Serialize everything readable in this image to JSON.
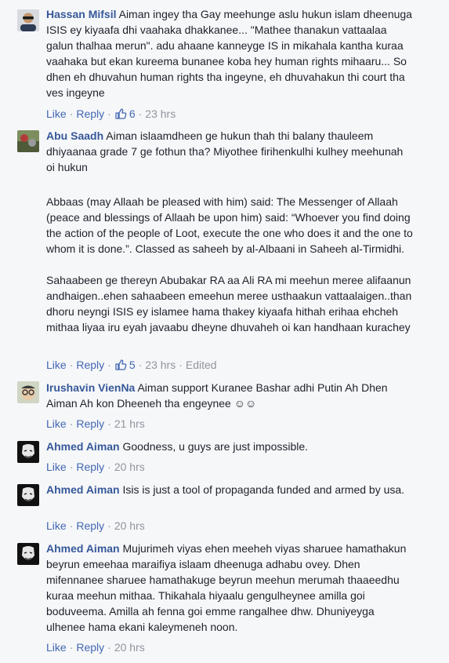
{
  "action_labels": {
    "like": "Like",
    "reply": "Reply"
  },
  "comments": [
    {
      "author": "Hassan Mifsil",
      "paragraphs": [
        "Aiman ingey tha Gay meehunge aslu hukun islam dheenuga ISIS ey kiyaafa dhi vaahaka dhakkanee... \"Mathee thanakun vattaalaa galun thalhaa merun\". adu ahaane kanneyge IS in mikahala kantha kuraa vaahaka but ekan kureema bunanee koba hey human rights mihaaru... So dhen eh dhuvahun human rights tha ingeyne, eh dhuvahakun thi court tha ves ingeyne"
      ],
      "likes": "6",
      "time": "23 hrs",
      "edited": ""
    },
    {
      "author": "Abu Saadh",
      "paragraphs": [
        "Aiman islaamdheen ge hukun thah thi balany thauleem dhiyaanaa grade 7 ge fothun tha? Miyothee firihenkulhi kulhey meehunah oi hukun",
        "Abbaas (may Allaah be pleased with him) said: The Messenger of Allaah (peace and blessings of Allaah be upon him) said: “Whoever you find doing the action of the people of Loot, execute the one who does it and the one to whom it is done.”. Classed as saheeh by al-Albaani in Saheeh al-Tirmidhi.",
        "Sahaabeen ge thereyn Abubakar RA aa Ali RA mi meehun meree alifaanun andhaigen..ehen sahaabeen emeehun meree usthaakun vattaalaigen..than dhoru neyngi ISIS ey islamee hama thakey kiyaafa hithah erihaa ehcheh mithaa liyaa iru eyah javaabu dheyne dhuvaheh oi kan handhaan kurachey"
      ],
      "likes": "5",
      "time": "23 hrs",
      "edited": "Edited"
    },
    {
      "author": "Irushavin VienNa",
      "paragraphs": [
        "Aiman support Kuranee Bashar adhi Putin Ah Dhen Aiman Ah kon Dheeneh tha engeynee ☺☺"
      ],
      "likes": "",
      "time": "21 hrs",
      "edited": ""
    },
    {
      "author": "Ahmed Aiman",
      "paragraphs": [
        "Goodness, u guys are just impossible."
      ],
      "likes": "",
      "time": "20 hrs",
      "edited": ""
    },
    {
      "author": "Ahmed Aiman",
      "paragraphs": [
        "Isis is just a tool of propaganda funded and armed by usa."
      ],
      "likes": "",
      "time": "20 hrs",
      "edited": ""
    },
    {
      "author": "Ahmed Aiman",
      "paragraphs": [
        "Mujurimeh viyas ehen meeheh viyas sharuee hamathakun beyrun emeehaa maraifiya islaam dheenuga adhabu ovey. Dhen mifennanee sharuee hamathakuge beyrun meehun merumah thaaeedhu kuraa meehun mithaa. Thikahala hiyaalu gengulheynee amilla goi boduveema. Amilla ah fenna goi emme rangalhee dhw. Dhuniyeyga ulhenee hama ekani kaleymeneh noon."
      ],
      "likes": "",
      "time": "20 hrs",
      "edited": ""
    }
  ],
  "colors": {
    "link": "#4267b2",
    "name": "#365899",
    "meta": "#90949c",
    "background": "#f6f7f9"
  }
}
